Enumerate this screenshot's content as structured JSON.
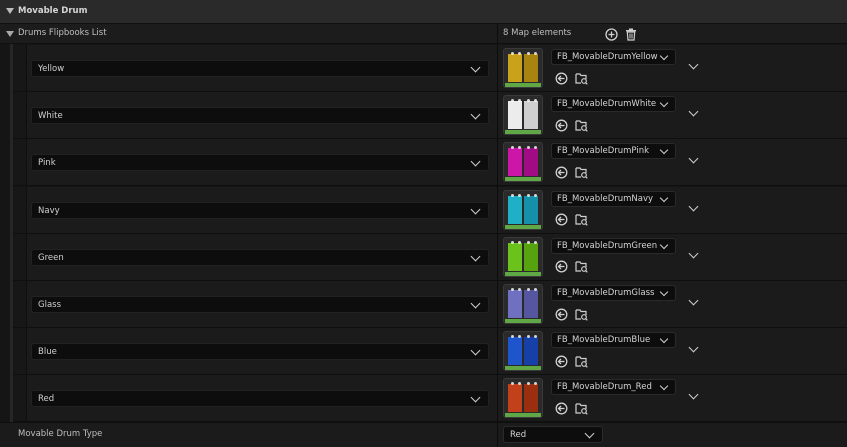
{
  "section": {
    "title": "Movable Drum"
  },
  "list": {
    "label": "Drums Flipbooks List",
    "count_text": "8 Map elements",
    "add_icon": "plus-circle-icon",
    "delete_icon": "trash-icon",
    "entries": [
      {
        "key": "Yellow",
        "asset": "FB_MovableDrumYellow",
        "color": "#c9a21a",
        "color_dark": "#a9830f",
        "band": "#5fa845"
      },
      {
        "key": "White",
        "asset": "FB_MovableDrumWhite",
        "color": "#ececec",
        "color_dark": "#cfcfcf",
        "band": "#5fa845"
      },
      {
        "key": "Pink",
        "asset": "FB_MovableDrumPink",
        "color": "#cc16a8",
        "color_dark": "#a10c84",
        "band": "#5fa845"
      },
      {
        "key": "Navy",
        "asset": "FB_MovableDrumNavy",
        "color": "#1fb0c8",
        "color_dark": "#1590a8",
        "band": "#5fa845"
      },
      {
        "key": "Green",
        "asset": "FB_MovableDrumGreen",
        "color": "#6bc21a",
        "color_dark": "#56a20f",
        "band": "#5fa845"
      },
      {
        "key": "Glass",
        "asset": "FB_MovableDrumGlass",
        "color": "#7070c0",
        "color_dark": "#5656a0",
        "band": "#5fa845"
      },
      {
        "key": "Blue",
        "asset": "FB_MovableDrumBlue",
        "color": "#1f55cc",
        "color_dark": "#173fa8",
        "band": "#5fa845"
      },
      {
        "key": "Red",
        "asset": "FB_MovableDrum_Red",
        "color": "#c2401a",
        "color_dark": "#9a2f10",
        "band": "#5fa845"
      }
    ]
  },
  "footer": {
    "label": "Movable Drum Type",
    "value": "Red"
  }
}
